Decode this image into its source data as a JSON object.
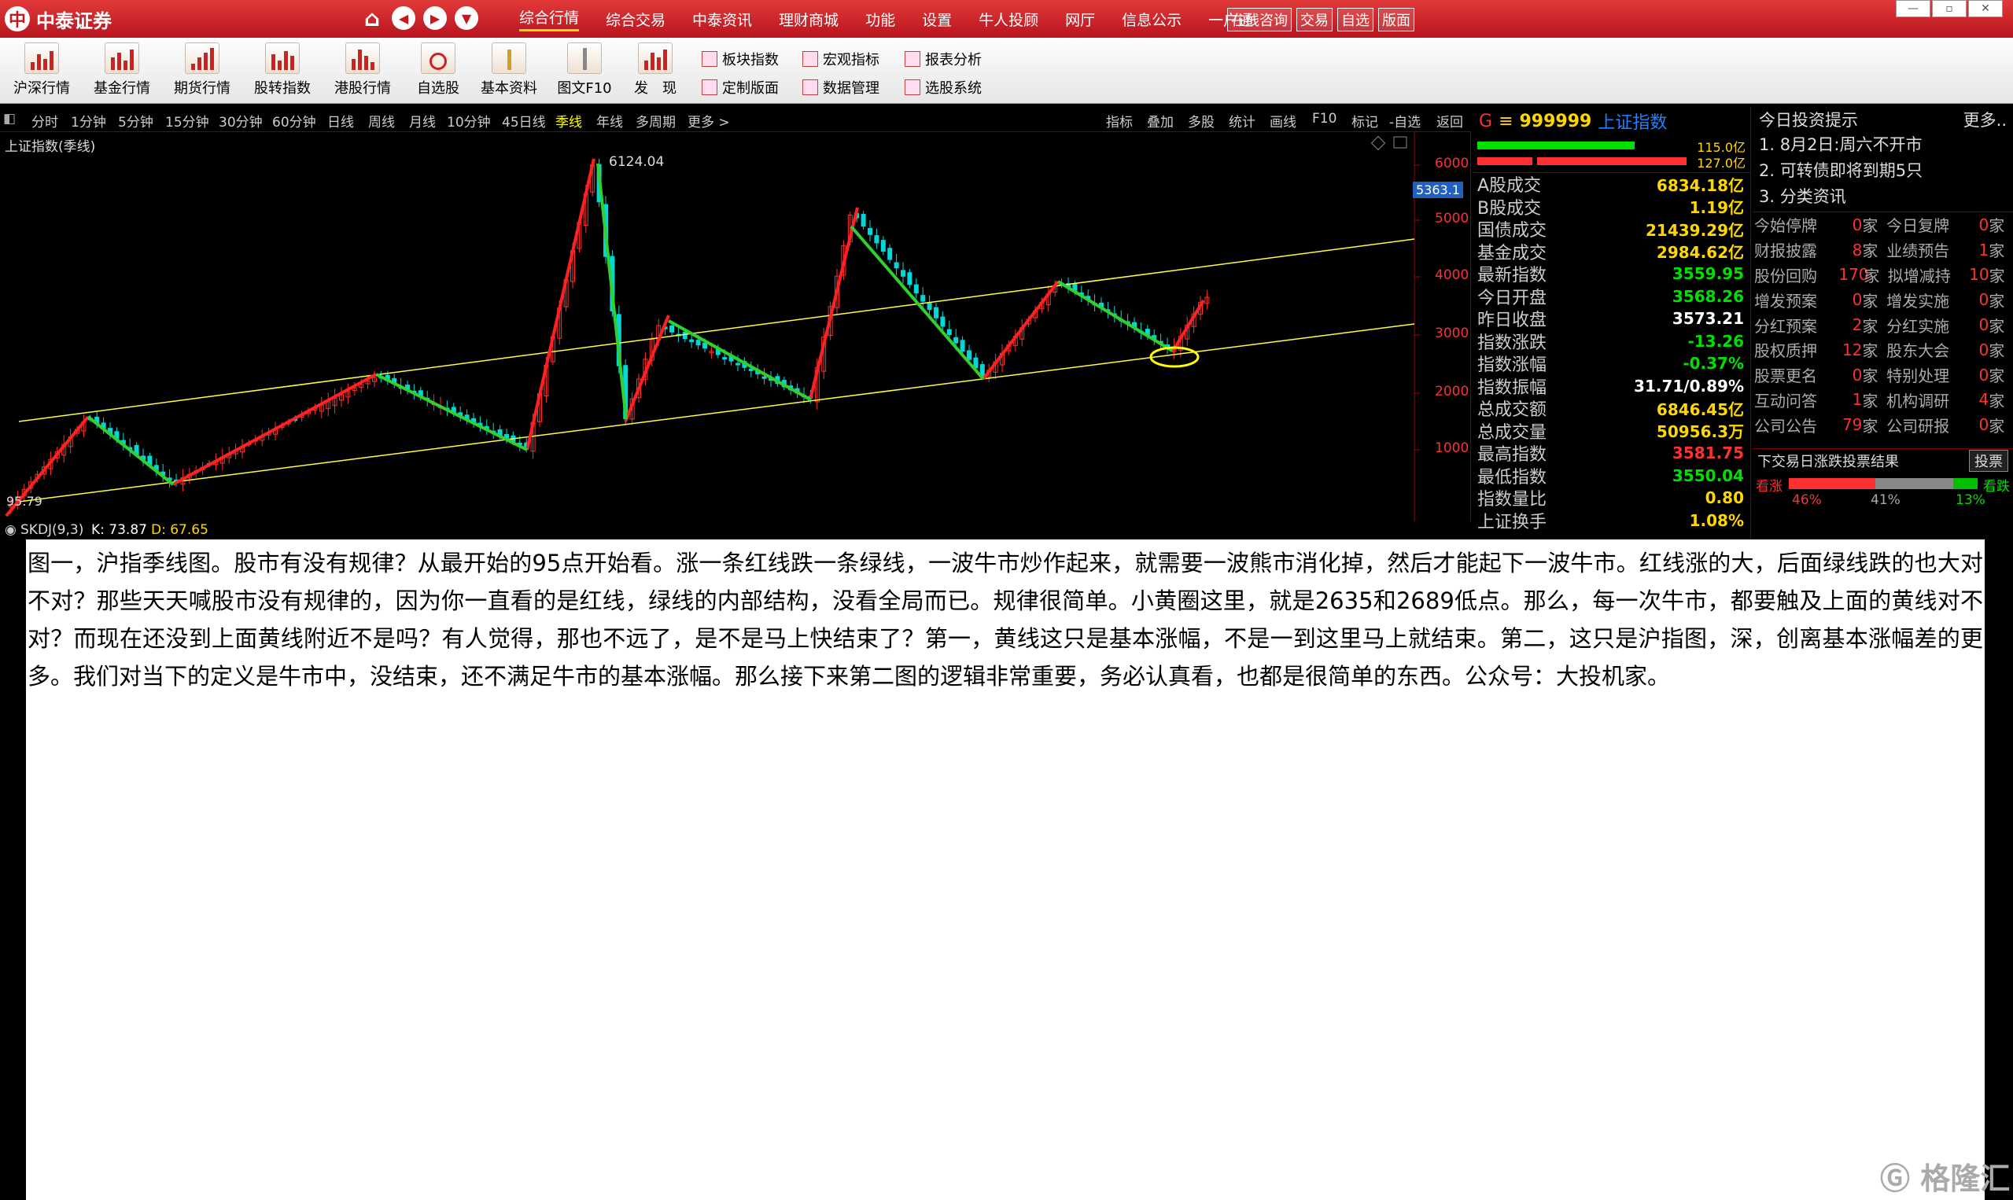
{
  "app": {
    "name": "中泰证券",
    "logo_symbol": "中"
  },
  "nav_buttons": [
    "⌂",
    "◀",
    "▶",
    "▼"
  ],
  "top_menu": [
    "综合行情",
    "综合交易",
    "中泰资讯",
    "理财商城",
    "功能",
    "设置",
    "牛人投顾",
    "网厅",
    "信息公示",
    "一户通"
  ],
  "quick_buttons": [
    "在线咨询",
    "交易",
    "自选",
    "版面"
  ],
  "window_controls": [
    "—",
    "▫",
    "✕"
  ],
  "toolbar": {
    "items": [
      "沪深行情",
      "基金行情",
      "期货行情",
      "股转指数",
      "港股行情",
      "自选股",
      "基本资料",
      "图文F10",
      "发　现"
    ],
    "small": [
      "板块指数",
      "宏观指标",
      "报表分析",
      "定制版面",
      "数据管理",
      "选股系统"
    ]
  },
  "periods": [
    "分时",
    "1分钟",
    "5分钟",
    "15分钟",
    "30分钟",
    "60分钟",
    "日线",
    "周线",
    "月线",
    "10分钟",
    "45日线",
    "季线",
    "年线",
    "多周期",
    "更多 >"
  ],
  "active_period": "季线",
  "right_tools": [
    "指标",
    "叠加",
    "多股",
    "统计",
    "画线",
    "F10",
    "标记",
    "-自选",
    "返回"
  ],
  "chart": {
    "title": "上证指数(季线)",
    "peak_label": "6124.04",
    "low_label": "95.79",
    "current_tag": "5363.1",
    "y_ticks": [
      "6000",
      "5000",
      "4000",
      "3000",
      "2000",
      "1000"
    ],
    "indicator": {
      "name": "SKDJ(9,3)",
      "k": "K: 73.87",
      "d": "D: 67.65"
    }
  },
  "chart_data": {
    "type": "candlestick",
    "title": "上证指数(季线)",
    "y_ticks": [
      1000,
      2000,
      3000,
      4000,
      5000,
      6000
    ],
    "peak": 6124.04,
    "low": 95.79,
    "trend_channel": "yellow parallel lines",
    "red_wave_up_legs": 5,
    "green_wave_down_legs": 5,
    "highlight": "yellow ellipse near recent low"
  },
  "quote": {
    "code": "999999",
    "name": "上证指数",
    "prefix": "G",
    "bar_values": [
      "115.0亿",
      "127.0亿"
    ],
    "rows": [
      {
        "label": "A股成交",
        "value": "6834.18亿",
        "color": "#ffd700"
      },
      {
        "label": "B股成交",
        "value": "1.19亿",
        "color": "#ffd700"
      },
      {
        "label": "国债成交",
        "value": "21439.29亿",
        "color": "#ffd700"
      },
      {
        "label": "基金成交",
        "value": "2984.62亿",
        "color": "#ffd700"
      },
      {
        "label": "最新指数",
        "value": "3559.95",
        "color": "#00e000"
      },
      {
        "label": "今日开盘",
        "value": "3568.26",
        "color": "#00e000"
      },
      {
        "label": "昨日收盘",
        "value": "3573.21",
        "color": "#ffffff"
      },
      {
        "label": "指数涨跌",
        "value": "-13.26",
        "color": "#00e000"
      },
      {
        "label": "指数涨幅",
        "value": "-0.37%",
        "color": "#00e000"
      },
      {
        "label": "指数振幅",
        "value": "31.71/0.89%",
        "color": "#ffffff"
      },
      {
        "label": "总成交额",
        "value": "6846.45亿",
        "color": "#ffd700"
      },
      {
        "label": "总成交量",
        "value": "50956.3万",
        "color": "#ffd700"
      },
      {
        "label": "最高指数",
        "value": "3581.75",
        "color": "#ff3030"
      },
      {
        "label": "最低指数",
        "value": "3550.04",
        "color": "#00e000"
      },
      {
        "label": "指数量比",
        "value": "0.80",
        "color": "#ffd700"
      },
      {
        "label": "上证换手",
        "value": "1.08%",
        "color": "#ffd700"
      }
    ]
  },
  "info": {
    "title": "今日投资提示",
    "more": "更多..",
    "items": [
      "1. 8月2日:周六不开市",
      "2. 可转债即将到期5只",
      "3. 分类资讯"
    ],
    "grid": [
      [
        "今始停牌",
        "0",
        "家",
        "今日复牌",
        "0",
        "家"
      ],
      [
        "财报披露",
        "8",
        "家",
        "业绩预告",
        "1",
        "家"
      ],
      [
        "股份回购",
        "170",
        "家",
        "拟增减持",
        "10",
        "家"
      ],
      [
        "增发预案",
        "0",
        "家",
        "增发实施",
        "0",
        "家"
      ],
      [
        "分红预案",
        "2",
        "家",
        "分红实施",
        "0",
        "家"
      ],
      [
        "股权质押",
        "12",
        "家",
        "股东大会",
        "0",
        "家"
      ],
      [
        "股票更名",
        "0",
        "家",
        "特别处理",
        "0",
        "家"
      ],
      [
        "互动问答",
        "1",
        "家",
        "机构调研",
        "4",
        "家"
      ],
      [
        "公司公告",
        "79",
        "家",
        "公司研报",
        "0",
        "家"
      ]
    ],
    "vote": {
      "title": "下交易日涨跌投票结果",
      "button": "投票",
      "up_label": "看涨",
      "down_label": "看跌",
      "up_pct": "46%",
      "flat_pct": "41%",
      "down_pct": "13%",
      "up": 46,
      "flat": 41,
      "down": 13
    }
  },
  "annotation": "图一，沪指季线图。股市有没有规律？从最开始的95点开始看。涨一条红线跌一条绿线，一波牛市炒作起来，就需要一波熊市消化掉，然后才能起下一波牛市。红线涨的大，后面绿线跌的也大对不对？那些天天喊股市没有规律的，因为你一直看的是红线，绿线的内部结构，没看全局而已。规律很简单。小黄圈这里，就是2635和2689低点。那么，每一次牛市，都要触及上面的黄线对不对？而现在还没到上面黄线附近不是吗？有人觉得，那也不远了，是不是马上快结束了？第一，黄线这只是基本涨幅，不是一到这里马上就结束。第二，这只是沪指图，深，创离基本涨幅差的更多。我们对当下的定义是牛市中，没结束，还不满足牛市的基本涨幅。那么接下来第二图的逻辑非常重要，务必认真看，也都是很简单的东西。公众号：大投机家。",
  "watermark": "格隆汇"
}
